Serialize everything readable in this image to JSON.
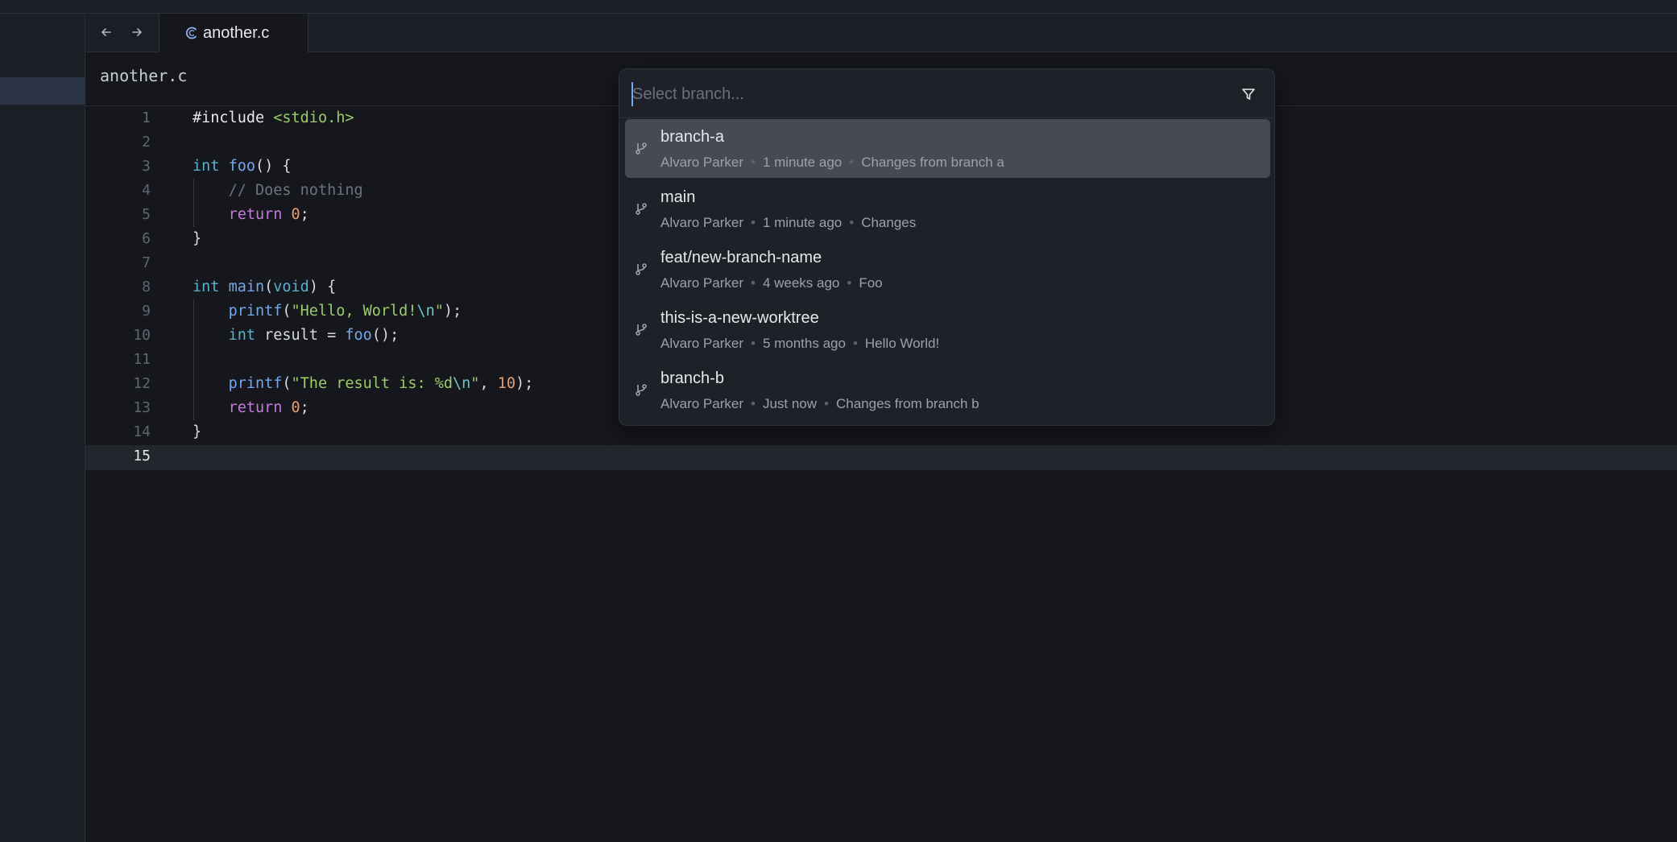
{
  "tab": {
    "filename": "another.c"
  },
  "breadcrumb": "another.c",
  "editor": {
    "line_numbers": [
      "1",
      "2",
      "3",
      "4",
      "5",
      "6",
      "7",
      "8",
      "9",
      "10",
      "11",
      "12",
      "13",
      "14",
      "15"
    ],
    "active_line": "15"
  },
  "branch_picker": {
    "placeholder": "Select branch...",
    "branches": [
      {
        "name": "branch-a",
        "author": "Alvaro Parker",
        "time": "1 minute ago",
        "message": "Changes from branch a"
      },
      {
        "name": "main",
        "author": "Alvaro Parker",
        "time": "1 minute ago",
        "message": "Changes"
      },
      {
        "name": "feat/new-branch-name",
        "author": "Alvaro Parker",
        "time": "4 weeks ago",
        "message": "Foo"
      },
      {
        "name": "this-is-a-new-worktree",
        "author": "Alvaro Parker",
        "time": "5 months ago",
        "message": "Hello World!"
      },
      {
        "name": "branch-b",
        "author": "Alvaro Parker",
        "time": "Just now",
        "message": "Changes from branch b"
      }
    ]
  }
}
